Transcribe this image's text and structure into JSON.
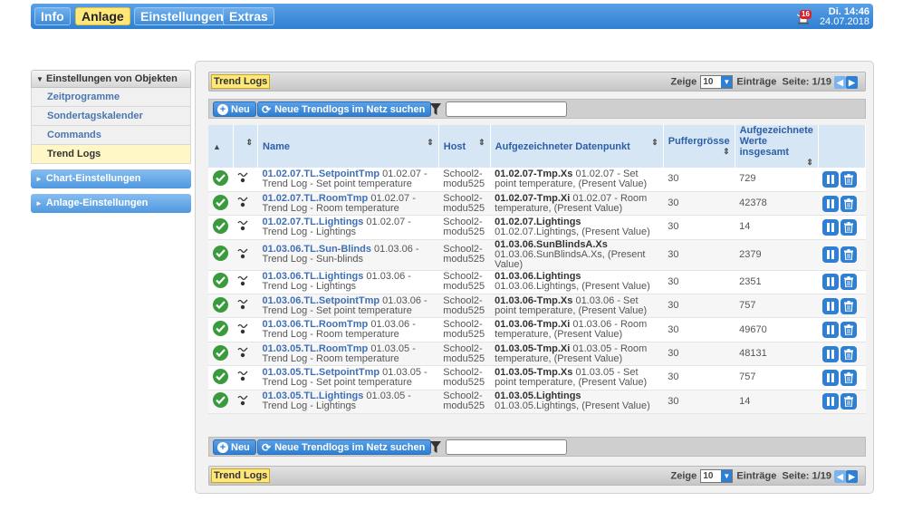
{
  "nav": {
    "tabs": [
      {
        "label": "Info",
        "active": false
      },
      {
        "label": "Anlage",
        "active": true
      },
      {
        "label": "Einstellungen",
        "active": false
      },
      {
        "label": "Extras",
        "active": false
      }
    ],
    "alarm_count": "16",
    "clock_time": "Di. 14:46",
    "clock_date": "24.07.2018"
  },
  "sidebar": {
    "header": "Einstellungen von Objekten",
    "items": [
      {
        "label": "Zeitprogramme",
        "active": false
      },
      {
        "label": "Sondertagskalender",
        "active": false
      },
      {
        "label": "Commands",
        "active": false
      },
      {
        "label": "Trend Logs",
        "active": true
      }
    ],
    "groups": [
      "Chart-Einstellungen",
      "Anlage-Einstellungen"
    ]
  },
  "panel": {
    "title": "Trend Logs",
    "pager": {
      "show_label": "Zeige",
      "page_size": "10",
      "entries_label": "Einträge",
      "page_label": "Seite: 1/19"
    },
    "toolbar": {
      "new_label": "Neu",
      "search_label": "Neue Trendlogs im Netz suchen",
      "filter_value": ""
    },
    "columns": [
      "Name",
      "Host",
      "Aufgezeichneter Datenpunkt",
      "Puffergrösse",
      "Aufgezeichnete Werte insgesamt"
    ],
    "rows": [
      {
        "name": "01.02.07.TL.SetpointTmp",
        "name_desc": " 01.02.07 - Trend Log - Set point temperature",
        "host": "School2-modu525",
        "dp": "01.02.07-Tmp.Xs",
        "dp_desc": " 01.02.07 - Set point temperature, (Present Value)",
        "buffer": "30",
        "total": "729"
      },
      {
        "name": "01.02.07.TL.RoomTmp",
        "name_desc": " 01.02.07 - Trend Log - Room temperature",
        "host": "School2-modu525",
        "dp": "01.02.07-Tmp.Xi",
        "dp_desc": " 01.02.07 - Room temperature, (Present Value)",
        "buffer": "30",
        "total": "42378"
      },
      {
        "name": "01.02.07.TL.Lightings",
        "name_desc": " 01.02.07 - Trend Log - Lightings",
        "host": "School2-modu525",
        "dp": "01.02.07.Lightings",
        "dp_desc": " 01.02.07.Lightings, (Present Value)",
        "buffer": "30",
        "total": "14"
      },
      {
        "name": "01.03.06.TL.Sun-Blinds",
        "name_desc": " 01.03.06 - Trend Log - Sun-blinds",
        "host": "School2-modu525",
        "dp": "01.03.06.SunBlindsA.Xs",
        "dp_desc": " 01.03.06.SunBlindsA.Xs, (Present Value)",
        "buffer": "30",
        "total": "2379"
      },
      {
        "name": "01.03.06.TL.Lightings",
        "name_desc": " 01.03.06 - Trend Log - Lightings",
        "host": "School2-modu525",
        "dp": "01.03.06.Lightings",
        "dp_desc": " 01.03.06.Lightings, (Present Value)",
        "buffer": "30",
        "total": "2351"
      },
      {
        "name": "01.03.06.TL.SetpointTmp",
        "name_desc": " 01.03.06 - Trend Log - Set point temperature",
        "host": "School2-modu525",
        "dp": "01.03.06-Tmp.Xs",
        "dp_desc": " 01.03.06 - Set point temperature, (Present Value)",
        "buffer": "30",
        "total": "757"
      },
      {
        "name": "01.03.06.TL.RoomTmp",
        "name_desc": " 01.03.06 - Trend Log - Room temperature",
        "host": "School2-modu525",
        "dp": "01.03.06-Tmp.Xi",
        "dp_desc": " 01.03.06 - Room temperature, (Present Value)",
        "buffer": "30",
        "total": "49670"
      },
      {
        "name": "01.03.05.TL.RoomTmp",
        "name_desc": " 01.03.05 - Trend Log - Room temperature",
        "host": "School2-modu525",
        "dp": "01.03.05-Tmp.Xi",
        "dp_desc": " 01.03.05 - Room temperature, (Present Value)",
        "buffer": "30",
        "total": "48131"
      },
      {
        "name": "01.03.05.TL.SetpointTmp",
        "name_desc": " 01.03.05 - Trend Log - Set point temperature",
        "host": "School2-modu525",
        "dp": "01.03.05-Tmp.Xs",
        "dp_desc": " 01.03.05 - Set point temperature, (Present Value)",
        "buffer": "30",
        "total": "757"
      },
      {
        "name": "01.03.05.TL.Lightings",
        "name_desc": " 01.03.05 - Trend Log - Lightings",
        "host": "School2-modu525",
        "dp": "01.03.05.Lightings",
        "dp_desc": " 01.03.05.Lightings, (Present Value)",
        "buffer": "30",
        "total": "14"
      }
    ]
  },
  "colors": {
    "accent": "#2f7fd2",
    "highlight": "#ffe77a",
    "ok": "#3a9a3e",
    "link": "#3f6fb6"
  }
}
